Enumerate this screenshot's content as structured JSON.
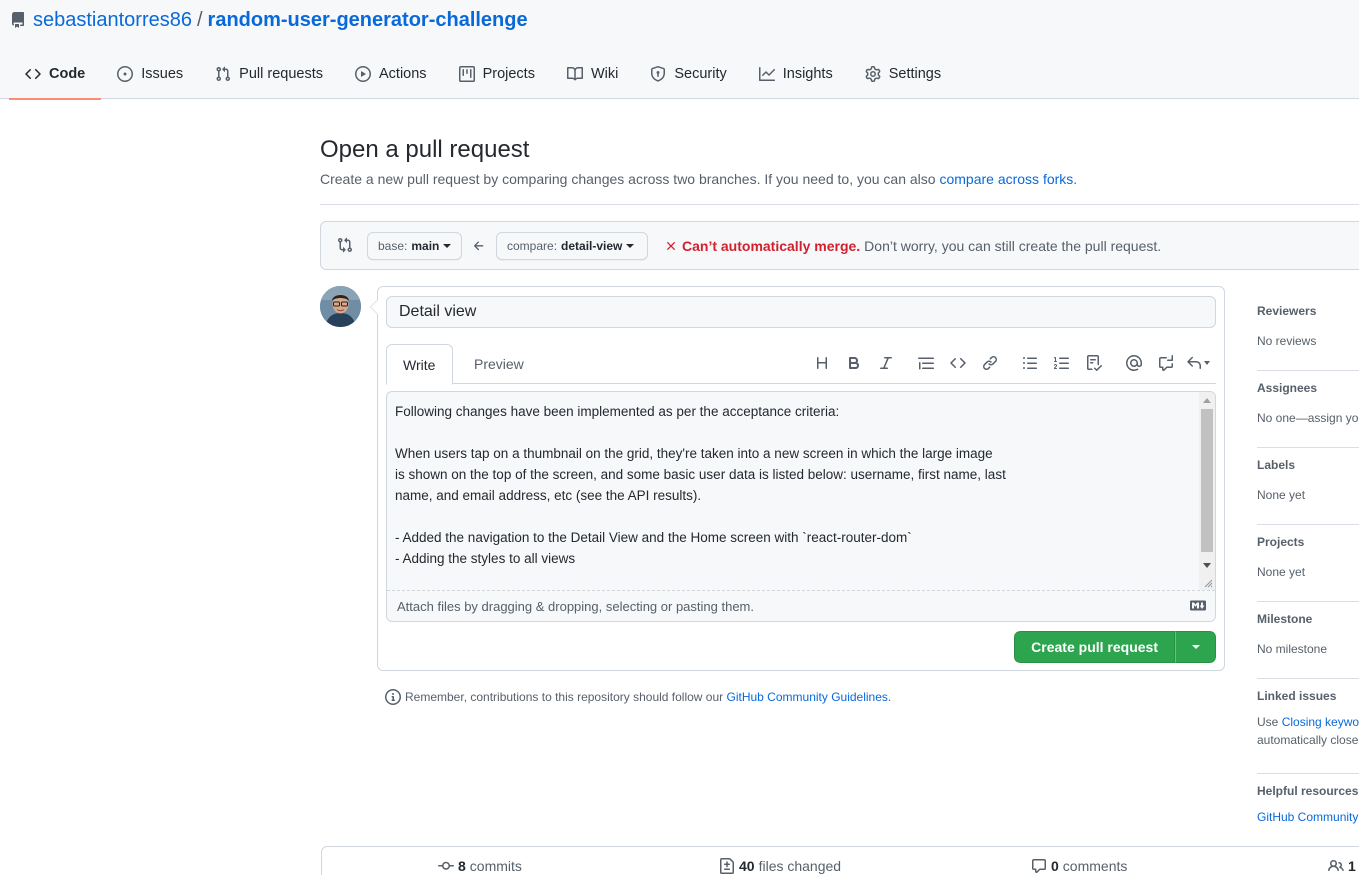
{
  "repo": {
    "owner": "sebastiantorres86",
    "separator": "/",
    "name": "random-user-generator-challenge"
  },
  "nav": {
    "items": [
      {
        "label": "Code",
        "icon": "code-icon",
        "selected": true
      },
      {
        "label": "Issues",
        "icon": "issue-opened-icon"
      },
      {
        "label": "Pull requests",
        "icon": "git-pull-request-icon"
      },
      {
        "label": "Actions",
        "icon": "play-icon"
      },
      {
        "label": "Projects",
        "icon": "table-icon"
      },
      {
        "label": "Wiki",
        "icon": "book-icon"
      },
      {
        "label": "Security",
        "icon": "shield-icon"
      },
      {
        "label": "Insights",
        "icon": "graph-icon"
      },
      {
        "label": "Settings",
        "icon": "gear-icon"
      }
    ]
  },
  "page": {
    "title": "Open a pull request",
    "subtitle_prefix": "Create a new pull request by comparing changes across two branches. If you need to, you can also",
    "subtitle_link": "compare across forks",
    "subtitle_suffix": "."
  },
  "range": {
    "base_label": "base:",
    "base_branch": "main",
    "compare_label": "compare:",
    "compare_branch": "detail-view",
    "merge_status_bad": "Can’t automatically merge.",
    "merge_status_note": "Don’t worry, you can still create the pull request."
  },
  "composer": {
    "title_value": "Detail view",
    "tab_write": "Write",
    "tab_preview": "Preview",
    "body": "Following changes have been implemented as per the acceptance criteria:\n\nWhen users tap on a thumbnail on the grid, they're taken into a new screen in which the large image\nis shown on the top of the screen, and some basic user data is listed below: username, first name, last\nname, and email address, etc (see the API results).\n\n- Added the navigation to the Detail View and the Home screen with `react-router-dom`\n- Adding the styles to all views",
    "attach_hint": "Attach files by dragging & dropping, selecting or pasting them.",
    "create_button": "Create pull request"
  },
  "remember": {
    "prefix": "Remember, contributions to this repository should follow our",
    "link": "GitHub Community Guidelines",
    "suffix": "."
  },
  "sidebar": {
    "reviewers": {
      "heading": "Reviewers",
      "value": "No reviews"
    },
    "assignees": {
      "heading": "Assignees",
      "value": "No one—assign yourself"
    },
    "labels": {
      "heading": "Labels",
      "value": "None yet"
    },
    "projects": {
      "heading": "Projects",
      "value": "None yet"
    },
    "milestone": {
      "heading": "Milestone",
      "value": "No milestone"
    },
    "linked_issues": {
      "heading": "Linked issues",
      "prefix": "Use",
      "link": "Closing keywords",
      "line2": "automatically close"
    },
    "helpful": {
      "heading": "Helpful resources",
      "link": "GitHub Community"
    }
  },
  "stats": {
    "commits_count": "8",
    "commits_label": "commits",
    "files_count": "40",
    "files_label": "files changed",
    "comments_count": "0",
    "comments_label": "comments",
    "contributors_count": "1"
  },
  "colors": {
    "accent": "#0969da",
    "danger": "#cf222e",
    "success": "#2da44e",
    "nav_underline": "#fd8c73"
  }
}
